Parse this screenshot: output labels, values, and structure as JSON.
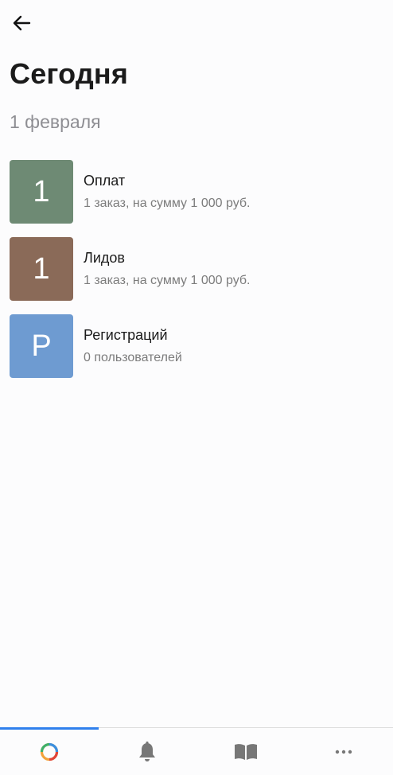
{
  "header": {
    "back_icon": "arrow-left-icon",
    "title": "Сегодня",
    "date": "1 февраля"
  },
  "items": [
    {
      "tile": "1",
      "tile_color": "#6e8a74",
      "title": "Оплат",
      "description": "1 заказ, на сумму 1 000 руб."
    },
    {
      "tile": "1",
      "tile_color": "#8a6a58",
      "title": "Лидов",
      "description": "1 заказ, на сумму 1 000 руб."
    },
    {
      "tile": "Р",
      "tile_color": "#6e9bd1",
      "title": "Регистраций",
      "description": "0 пользователей"
    }
  ],
  "bottom_nav": {
    "active_color": "#2f80ed",
    "tabs": [
      {
        "icon": "app-logo-ring-icon",
        "active": true
      },
      {
        "icon": "bell-icon",
        "active": false
      },
      {
        "icon": "book-icon",
        "active": false
      },
      {
        "icon": "more-dots-icon",
        "active": false
      }
    ]
  }
}
